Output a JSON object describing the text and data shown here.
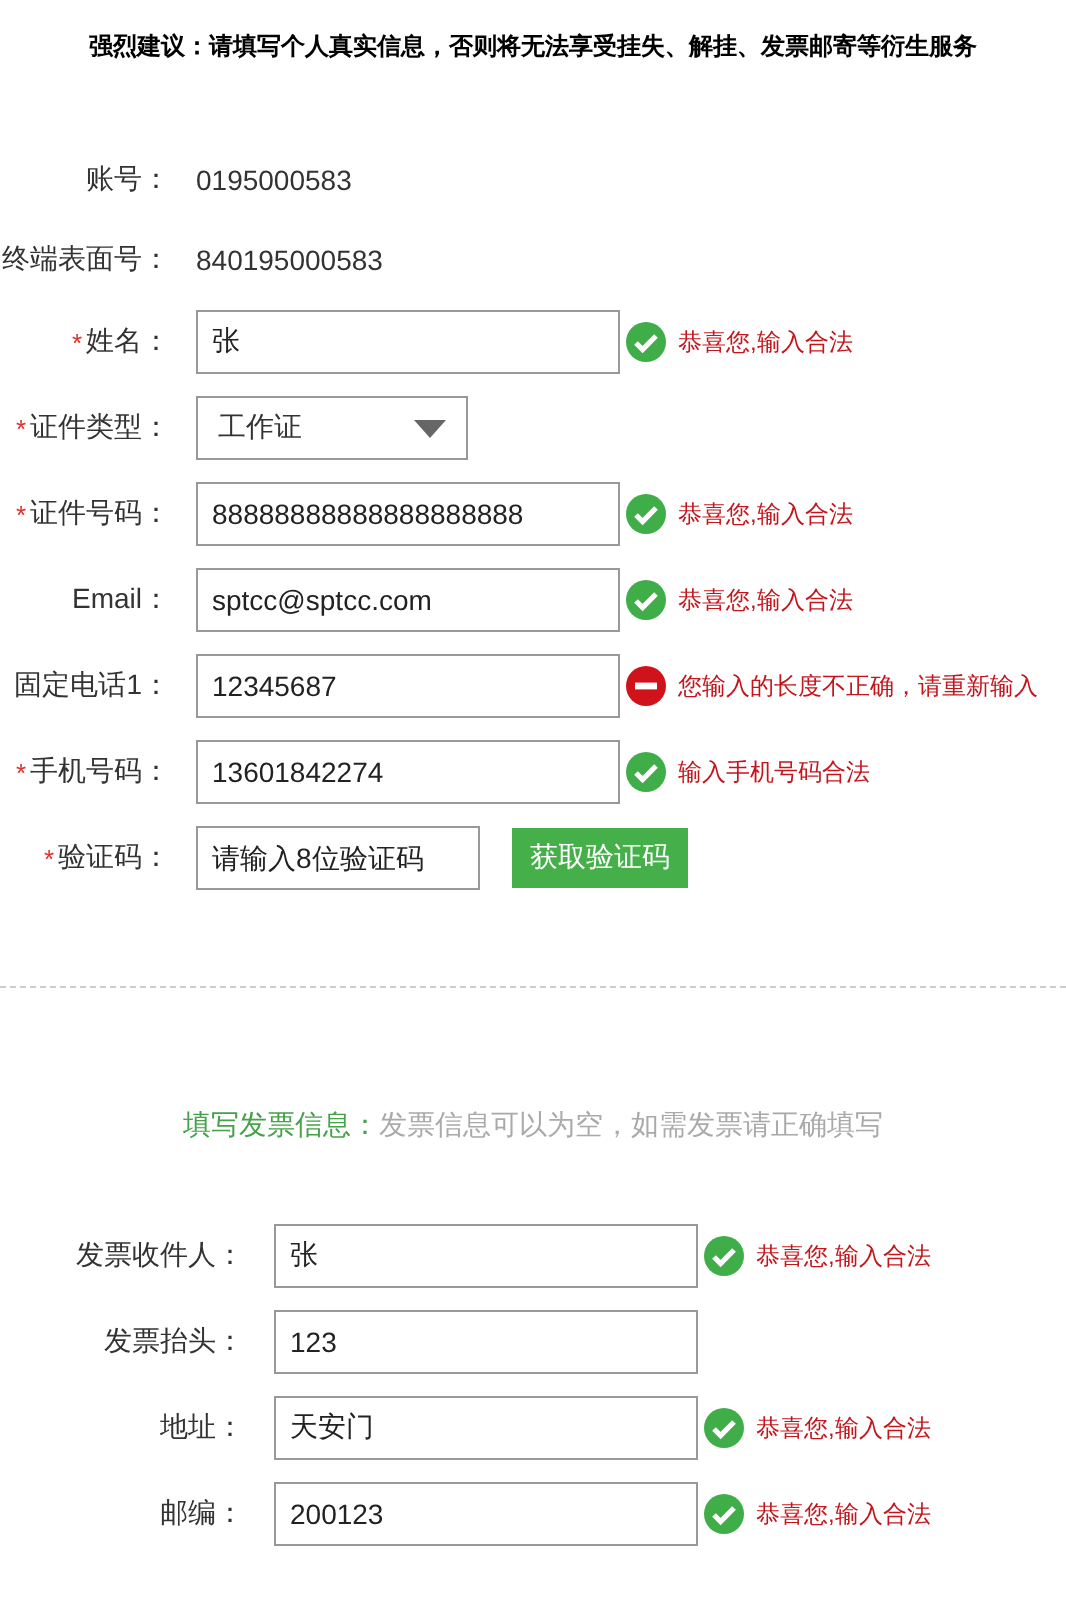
{
  "notice": {
    "lead": "强烈建议：",
    "text": "请填写个人真实信息，否则将无法享受挂失、解挂、发票邮寄等衍生服务"
  },
  "account_fields": [
    {
      "kind": "text",
      "label": "账号：",
      "value": "0195000583"
    },
    {
      "kind": "text",
      "label": "终端表面号：",
      "value": "840195000583"
    },
    {
      "kind": "input",
      "required_mark": "*",
      "label": "姓名：",
      "value": "张",
      "valid": true,
      "message": "恭喜您,输入合法"
    },
    {
      "kind": "select",
      "required_mark": "*",
      "label": "证件类型：",
      "value": "工作证"
    },
    {
      "kind": "input",
      "required_mark": "*",
      "label": "证件号码：",
      "value": "88888888888888888888",
      "valid": true,
      "message": "恭喜您,输入合法"
    },
    {
      "kind": "input",
      "label": "Email：",
      "value": "sptcc@sptcc.com",
      "valid": true,
      "message": "恭喜您,输入合法"
    },
    {
      "kind": "input",
      "label": "固定电话1：",
      "value": "12345687",
      "valid": false,
      "message": "您输入的长度不正确，请重新输入"
    },
    {
      "kind": "input",
      "required_mark": "*",
      "label": "手机号码：",
      "value": "13601842274",
      "valid": true,
      "message": "输入手机号码合法"
    },
    {
      "kind": "code",
      "required_mark": "*",
      "label": "验证码：",
      "placeholder": "请输入8位验证码",
      "button": "获取验证码"
    }
  ],
  "invoice": {
    "heading": "填写发票信息：",
    "hint": "发票信息可以为空，如需发票请正确填写",
    "fields": [
      {
        "kind": "input",
        "label": "发票收件人：",
        "value": "张",
        "valid": true,
        "message": "恭喜您,输入合法"
      },
      {
        "kind": "input",
        "label": "发票抬头：",
        "value": "123"
      },
      {
        "kind": "input",
        "label": "地址：",
        "value": "天安门",
        "valid": true,
        "message": "恭喜您,输入合法"
      },
      {
        "kind": "input",
        "label": "邮编：",
        "value": "200123",
        "valid": true,
        "message": "恭喜您,输入合法"
      }
    ]
  }
}
